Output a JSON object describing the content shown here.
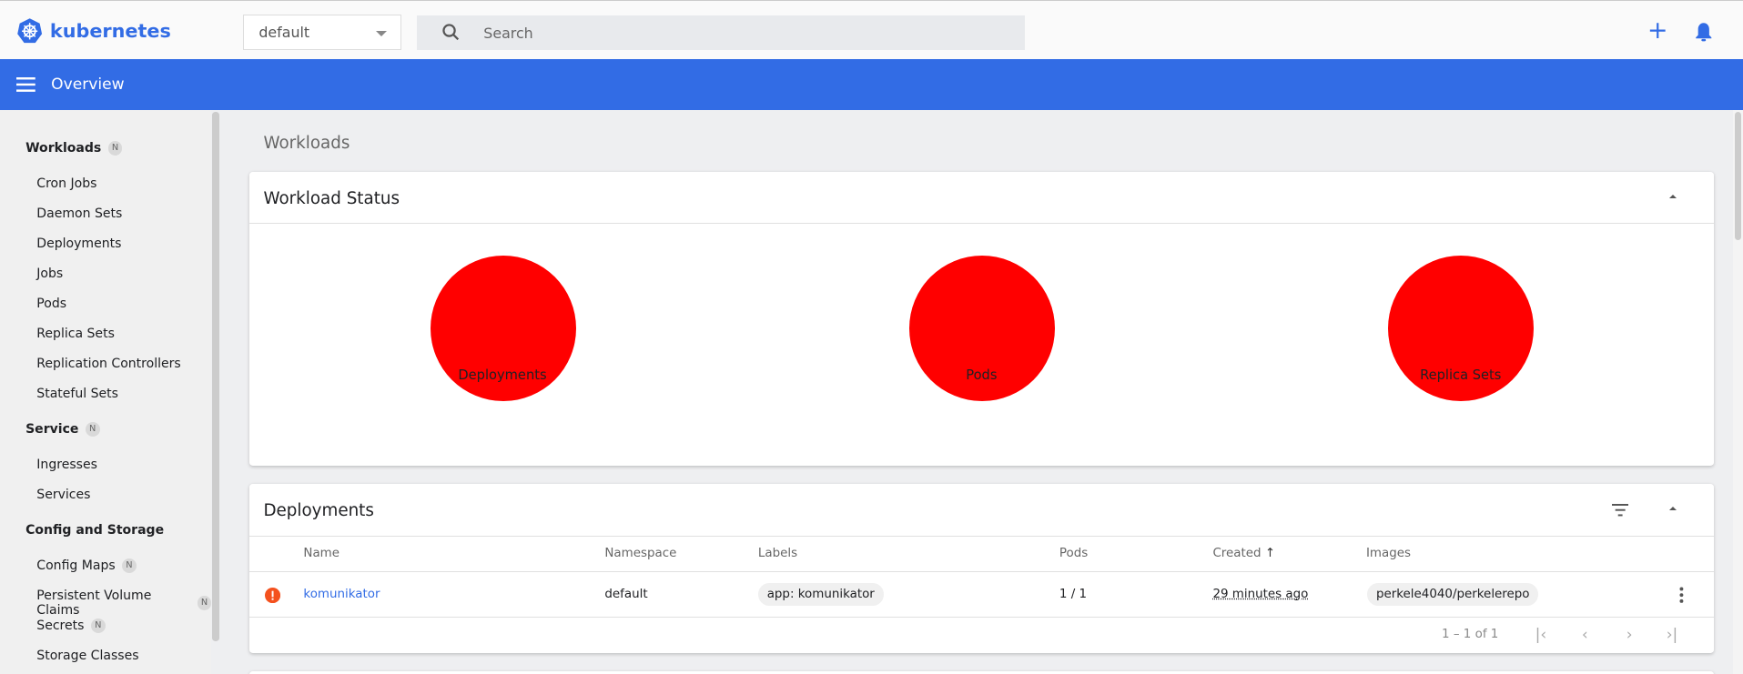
{
  "header": {
    "brand": "kubernetes",
    "namespace": "default",
    "search_placeholder": "Search",
    "brand_color": "#326ce5"
  },
  "toolbar": {
    "title": "Overview"
  },
  "sidebar": {
    "sections": [
      {
        "label": "Workloads",
        "badge": "N",
        "items": [
          {
            "label": "Cron Jobs"
          },
          {
            "label": "Daemon Sets"
          },
          {
            "label": "Deployments"
          },
          {
            "label": "Jobs"
          },
          {
            "label": "Pods"
          },
          {
            "label": "Replica Sets"
          },
          {
            "label": "Replication Controllers"
          },
          {
            "label": "Stateful Sets"
          }
        ]
      },
      {
        "label": "Service",
        "badge": "N",
        "items": [
          {
            "label": "Ingresses"
          },
          {
            "label": "Services"
          }
        ]
      },
      {
        "label": "Config and Storage",
        "items": [
          {
            "label": "Config Maps",
            "badge": "N"
          },
          {
            "label": "Persistent Volume Claims",
            "badge": "N"
          },
          {
            "label": "Secrets",
            "badge": "N"
          },
          {
            "label": "Storage Classes"
          }
        ]
      }
    ]
  },
  "main": {
    "title": "Workloads",
    "status": {
      "title": "Workload Status",
      "charts": [
        {
          "label": "Deployments",
          "color": "#ff0000"
        },
        {
          "label": "Pods",
          "color": "#ff0000"
        },
        {
          "label": "Replica Sets",
          "color": "#ff0000"
        }
      ]
    },
    "deployments": {
      "title": "Deployments",
      "columns": [
        "Name",
        "Namespace",
        "Labels",
        "Pods",
        "Created",
        "Images"
      ],
      "sort_arrow": "↑",
      "rows": [
        {
          "status": "error",
          "name": "komunikator",
          "namespace": "default",
          "labels": "app: komunikator",
          "pods": "1 / 1",
          "created": "29 minutes ago",
          "images": "perkele4040/perkelerepo"
        }
      ],
      "pagination": "1 – 1 of 1"
    }
  }
}
